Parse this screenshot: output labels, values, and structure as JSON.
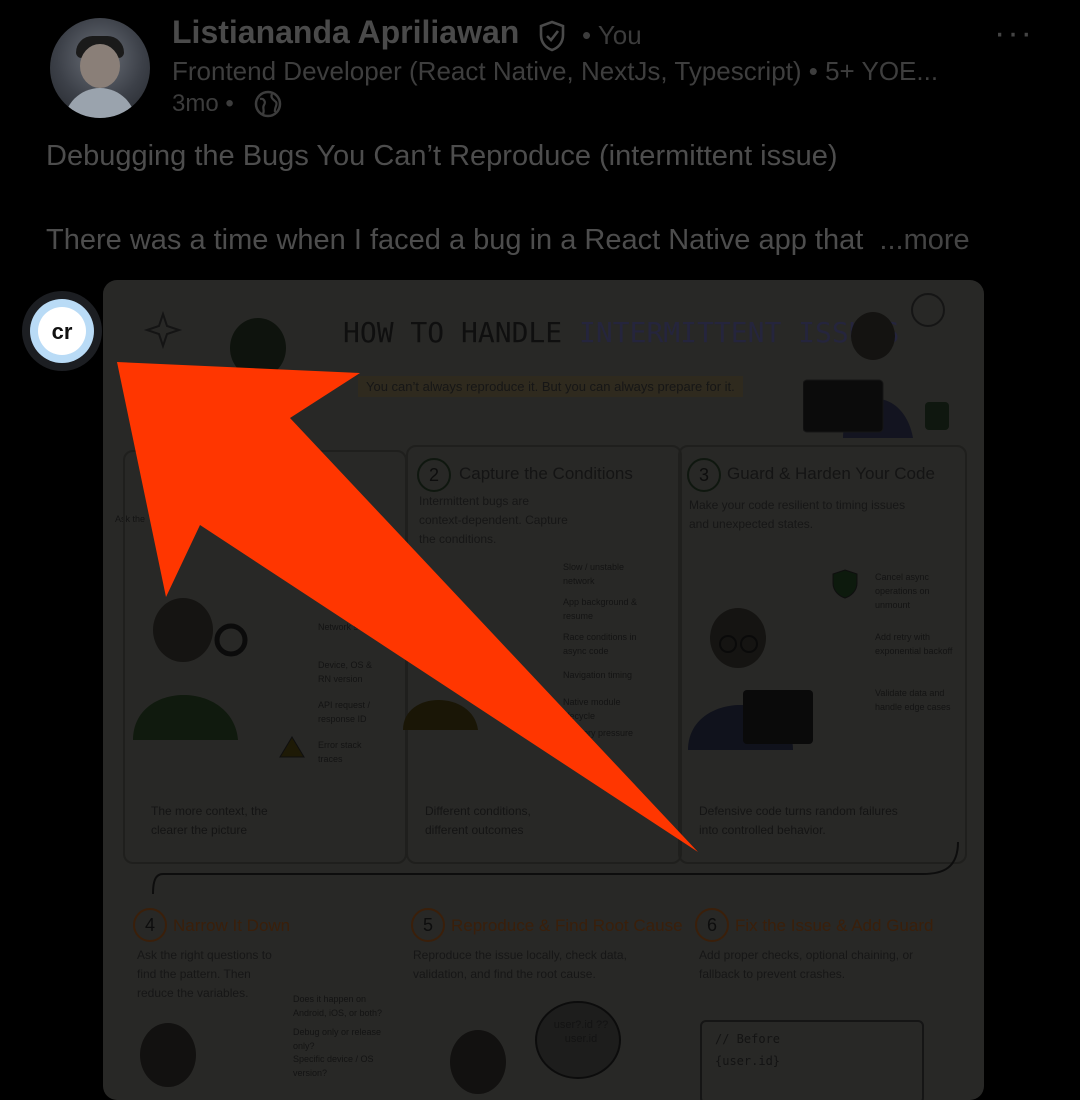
{
  "post": {
    "author_name": "Listiananda Apriliawan",
    "you_label": "• You",
    "headline": "Frontend Developer (React Native, NextJs, Typescript) • 5+ YOE...",
    "time_ago": "3mo •",
    "title": "Debugging the Bugs You Can’t Reproduce (intermittent issue)",
    "body": "There was a time when I faced a bug in a React Native app that",
    "more_link": "...more",
    "menu": "···"
  },
  "infographic": {
    "title_prefix": "HOW TO HANDLE",
    "title_highlight": "INTERMITTENT ISSUES",
    "subtitle": "You can’t always reproduce it. But you can always prepare for it.",
    "sections": [
      {
        "num": "2",
        "title": "Capture the Conditions",
        "text": "Intermittent bugs are context-dependent. Capture the conditions."
      },
      {
        "num": "3",
        "title": "Guard & Harden Your Code",
        "text": "Make your code resilient to timing issues and unexpected states."
      },
      {
        "num": "4",
        "title": "Narrow It Down",
        "text": "Ask the right questions to find the pattern. Then reduce the variables."
      },
      {
        "num": "5",
        "title": "Reproduce & Find Root Cause",
        "text": "Reproduce the issue locally, check data, validation, and find the root cause."
      },
      {
        "num": "6",
        "title": "Fix the Issue & Add Guard",
        "text": "Add proper checks, optional chaining, or fallback to prevent crashes."
      }
    ],
    "col1_items": [
      "Network status",
      "Device, OS & RN version",
      "API request / response ID",
      "Error stack traces"
    ],
    "col2_items": [
      "Slow / unstable network",
      "App background & resume",
      "Race conditions in async code",
      "Navigation timing",
      "Native module lifecycle",
      "Memory pressure"
    ],
    "col3_items": [
      "Cancel async operations on unmount",
      "Add retry with exponential backoff",
      "Validate data and handle edge cases"
    ],
    "col1_foot": "The more context, the clearer the picture",
    "col2_foot": "Different conditions, different outcomes",
    "col3_foot": "Defensive code turns random failures into controlled behavior.",
    "col4_items": [
      "Does it happen on Android, iOS, or both?",
      "Debug only or release only?",
      "Specific device / OS version?"
    ],
    "bubble": "user?.id ?? user.id",
    "code_before": "// Before",
    "code_line": "{user.id}",
    "left_partial": "Ask the"
  },
  "badge": {
    "label": "cr"
  },
  "colors": {
    "arrow": "#ff3600",
    "badge_ring": "#b9dbf6"
  }
}
